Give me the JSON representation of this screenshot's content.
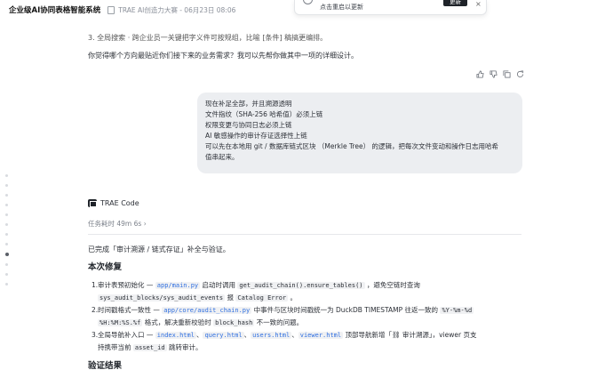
{
  "header": {
    "app_title": "企业级AI协同表格智能系统",
    "breadcrumb": "TRAE AI创造力大赛 - 06月23日 08:06"
  },
  "toast": {
    "message": "点击重启以更新",
    "button_label": "更新",
    "close_glyph": "×"
  },
  "chat": {
    "cut_line": "3. 全局搜索 · 跨企业员一关键把字义件可按规组，比喻 [条件] 稿搞更编排。",
    "question": "你觉得哪个方向最贴近你们接下来的业务需求？我可以先帮你做其中一项的详细设计。",
    "message_actions": [
      "thumbs-up-icon",
      "thumbs-down-icon",
      "copy-icon",
      "refresh-icon"
    ],
    "user_bubble": {
      "lines": [
        "现在补足全部，并且溯源透明",
        "文件指纹（SHA-256 哈希值）必须上链",
        "权限变更与协同日志必须上链",
        "AI 敏感操作的审计存证选择性上链",
        "可以先在本地用 git / 数据库链式区块 （Merkle Tree） 的逻辑，把每次文件变动和操作日志用哈希",
        "值串起来。"
      ]
    },
    "assistant": {
      "name": "TRAE Code",
      "elapsed": "任务耗时 49m 6s",
      "elapsed_chevron": "›",
      "intro": "已完成「审计溯源 / 链式存证」补全与验证。",
      "section_fix": "本次修复",
      "items": [
        {
          "num": "1.",
          "t1": "审计表预初始化 — ",
          "c1": "app/main.py",
          "t2": " 启动时调用 ",
          "c2": "get_audit_chain().ensure_tables()",
          "t3": " ，避免空链时查询",
          "c3": "sys_audit_blocks/sys_audit_events",
          "t4": " 报 ",
          "c4": "Catalog Error",
          "t5": " 。"
        },
        {
          "num": "2.",
          "t1": "时间戳格式一致性 — ",
          "c1": "app/core/audit_chain.py",
          "t2": " 中事件与区块时间戳统一为 DuckDB TIMESTAMP 往返一致的 ",
          "c2": "%Y-%m-%d",
          "c3": "%H:%M:%S.%f",
          "t3": " 格式，解决重新校验时 ",
          "c4": "block_hash",
          "t4": " 不一致的问题。"
        },
        {
          "num": "3.",
          "t1": "全局导航补入口 — ",
          "c1": "index.html",
          "sep": "、",
          "c2": "query.html",
          "c3": "users.html",
          "c4": "viewer.html",
          "t2": " 顶部导航新增「",
          "icon": "⛓",
          "t3": " 审计溯源」，viewer 页支",
          "t4": "持携带当前 ",
          "c5": "asset_id",
          "t5": " 跳转审计。"
        }
      ],
      "section_verify": "验证结果"
    }
  }
}
